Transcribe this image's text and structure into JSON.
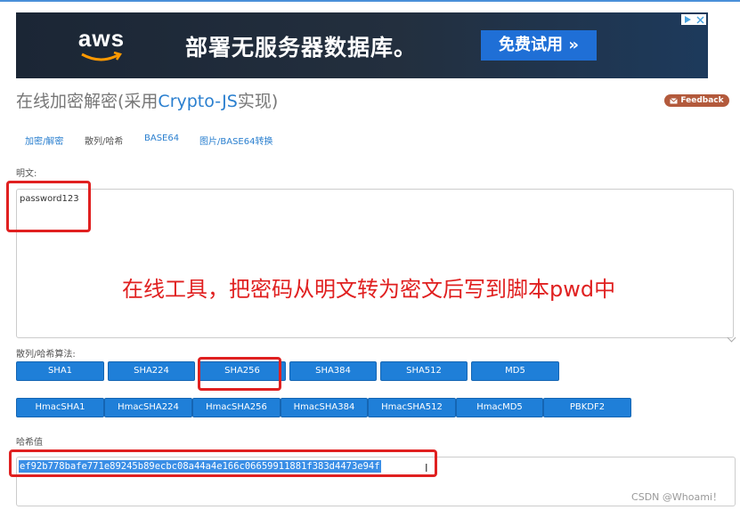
{
  "ad": {
    "logo_text": "aws",
    "headline": "部署无服务器数据库。",
    "cta": "免费试用 »",
    "badge_icons": [
      "ad-info-icon",
      "close-icon"
    ],
    "colors": {
      "bg": "#232f3e",
      "cta": "#1f6fd6",
      "smile": "#ff9900"
    }
  },
  "page": {
    "title_prefix": "在线加密解密(采用",
    "title_accent": "Crypto-JS",
    "title_suffix": "实现)",
    "feedback": "Feedback"
  },
  "tabs": [
    "加密/解密",
    "散列/哈希",
    "BASE64",
    "图片/BASE64转换"
  ],
  "plaintext": {
    "label": "明文:",
    "value": "password123"
  },
  "annotation": "在线工具，把密码从明文转为密文后写到脚本pwd中",
  "algorithms": {
    "label": "散列/哈希算法:",
    "row1": [
      "SHA1",
      "SHA224",
      "SHA256",
      "SHA384",
      "SHA512",
      "MD5"
    ],
    "row2": [
      "HmacSHA1",
      "HmacSHA224",
      "HmacSHA256",
      "HmacSHA384",
      "HmacSHA512",
      "HmacMD5",
      "PBKDF2"
    ]
  },
  "hash": {
    "label": "哈希值",
    "value": "ef92b778bafe771e89245b89ecbc08a44a4e166c06659911881f383d4473e94f"
  },
  "watermark": "CSDN @Whoami！",
  "colors": {
    "accent": "#2a7fcf",
    "button": "#1f7fd8",
    "highlight": "#e02020",
    "feedback": "#b35a3c"
  }
}
